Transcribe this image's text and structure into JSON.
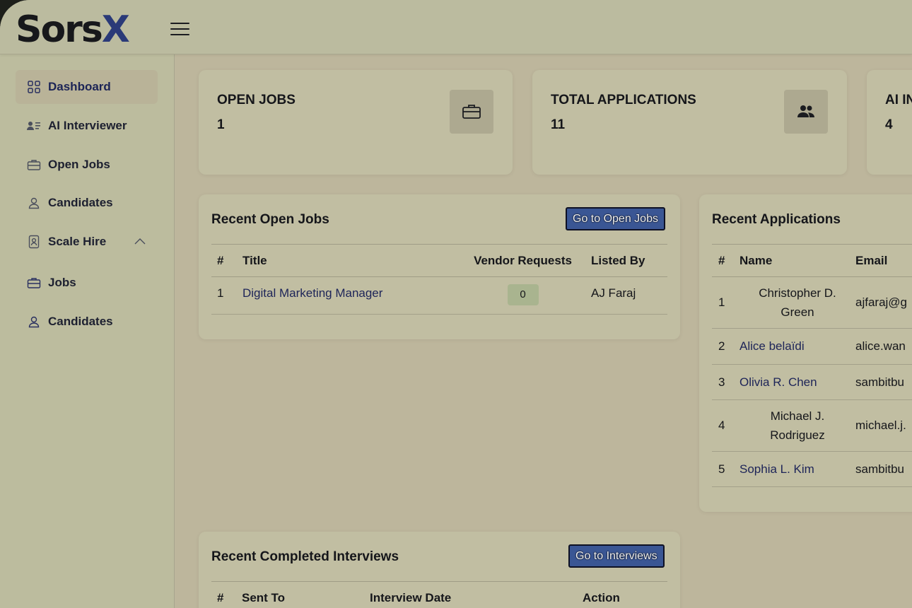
{
  "brand": {
    "logo_main": "Sors",
    "logo_accent": "X"
  },
  "sidebar": {
    "items": [
      {
        "label": "Dashboard",
        "icon": "grid-icon"
      },
      {
        "label": "AI Interviewer",
        "icon": "user-list-icon"
      },
      {
        "label": "Open Jobs",
        "icon": "briefcase-icon"
      },
      {
        "label": "Candidates",
        "icon": "user-icon"
      },
      {
        "label": "Scale Hire",
        "icon": "badge-icon"
      },
      {
        "label": "Jobs",
        "icon": "briefcase-icon"
      },
      {
        "label": "Candidates",
        "icon": "user-icon"
      }
    ]
  },
  "stats": [
    {
      "title": "OPEN JOBS",
      "value": "1",
      "icon": "briefcase-icon"
    },
    {
      "title": "TOTAL APPLICATIONS",
      "value": "11",
      "icon": "users-icon"
    },
    {
      "title": "AI IN",
      "value": "4"
    }
  ],
  "recent_open_jobs": {
    "title": "Recent Open Jobs",
    "button": "Go to Open Jobs",
    "headers": [
      "#",
      "Title",
      "Vendor Requests",
      "Listed By"
    ],
    "rows": [
      {
        "num": "1",
        "title": "Digital Marketing Manager",
        "vendor_requests": "0",
        "listed_by": "AJ Faraj"
      }
    ]
  },
  "recent_applications": {
    "title": "Recent Applications",
    "headers": [
      "#",
      "Name",
      "Email"
    ],
    "rows": [
      {
        "num": "1",
        "name_line1": "Christopher D.",
        "name_line2": "Green",
        "email": "ajfaraj@g"
      },
      {
        "num": "2",
        "name_line1": "Alice belaïdi",
        "name_line2": "",
        "email": "alice.wan"
      },
      {
        "num": "3",
        "name_line1": "Olivia R. Chen",
        "name_line2": "",
        "email": "sambitbu"
      },
      {
        "num": "4",
        "name_line1": "Michael J.",
        "name_line2": "Rodriguez",
        "email": "michael.j."
      },
      {
        "num": "5",
        "name_line1": "Sophia L. Kim",
        "name_line2": "",
        "email": "sambitbu"
      }
    ]
  },
  "recent_interviews": {
    "title": "Recent Completed Interviews",
    "button": "Go to Interviews",
    "headers": [
      "#",
      "Sent To",
      "Interview Date",
      "Action"
    ]
  },
  "colors": {
    "accent": "#2a3a78",
    "button": "#3a5694",
    "link": "#1d2458"
  }
}
